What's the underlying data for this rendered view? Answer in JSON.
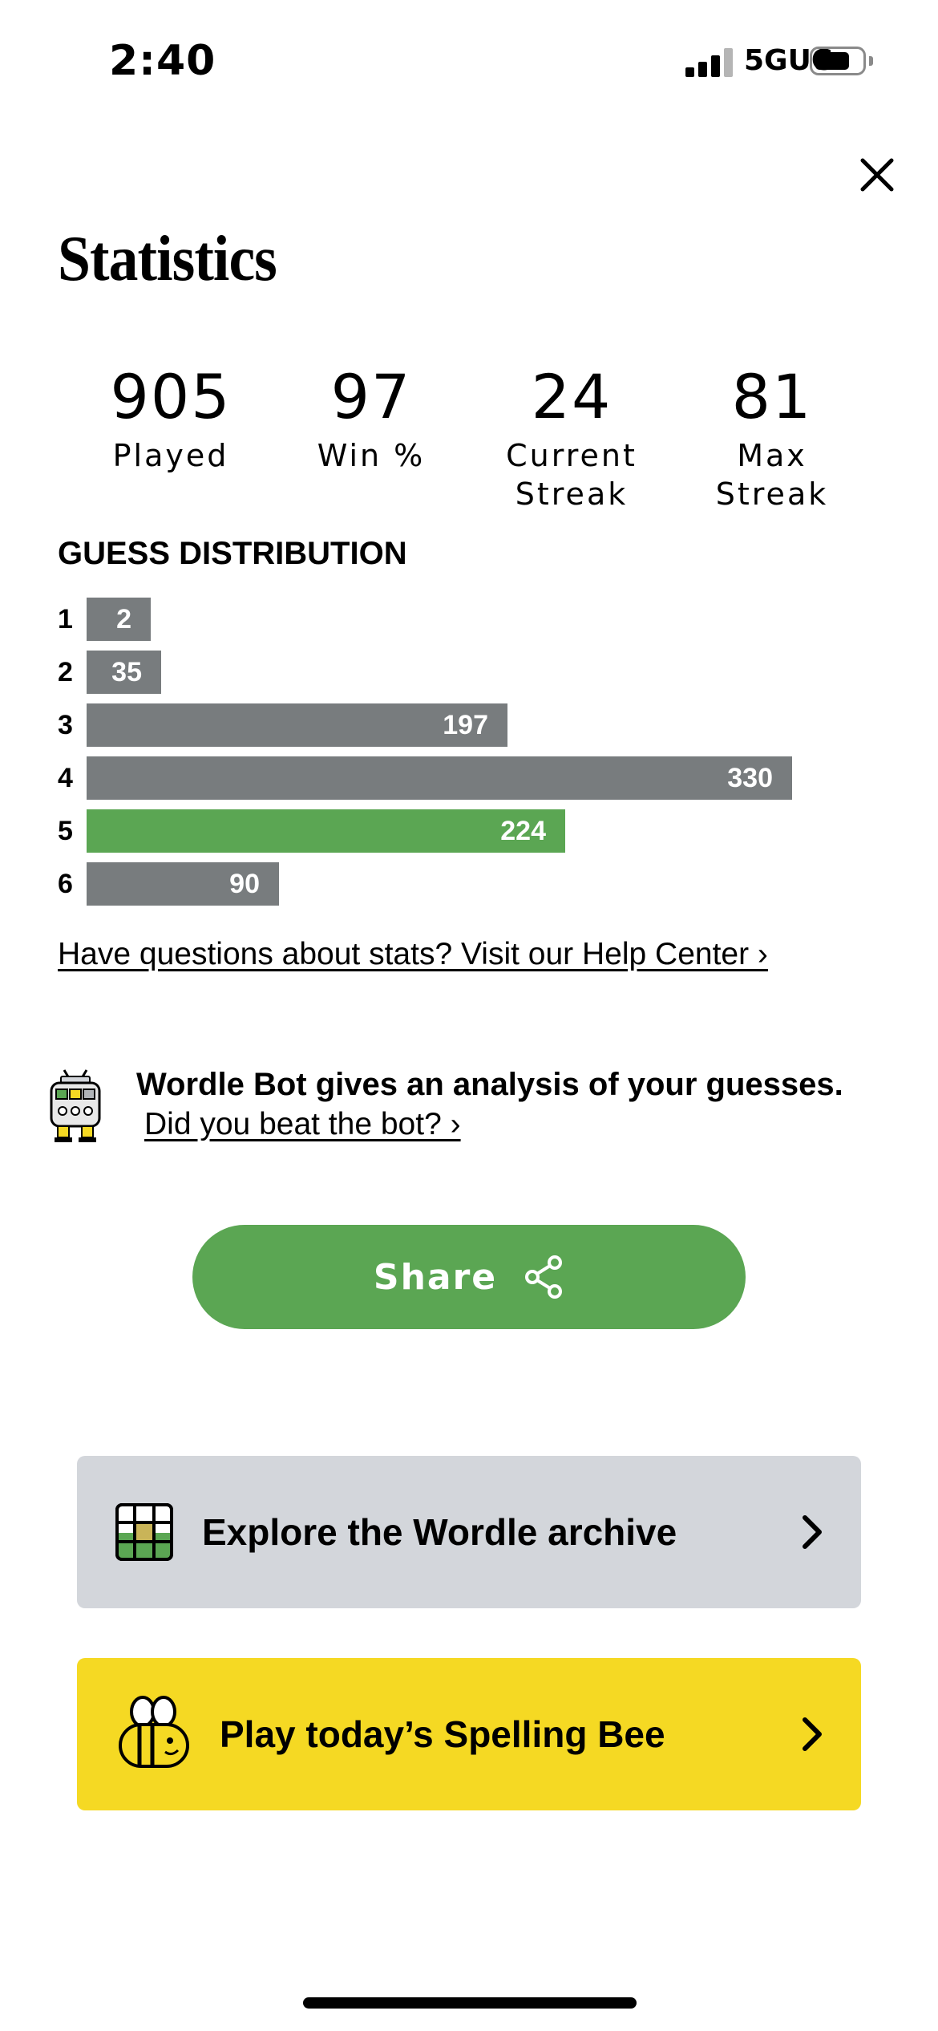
{
  "status_bar": {
    "time": "2:40",
    "network": "5GUC"
  },
  "title": "Statistics",
  "stats": [
    {
      "value": "905",
      "label": "Played"
    },
    {
      "value": "97",
      "label": "Win %"
    },
    {
      "value": "24",
      "label": "Current\nStreak"
    },
    {
      "value": "81",
      "label": "Max\nStreak"
    }
  ],
  "distribution": {
    "title": "GUESS DISTRIBUTION",
    "max": 330,
    "highlight_row": 5,
    "rows": [
      {
        "guess": "1",
        "count": 2
      },
      {
        "guess": "2",
        "count": 35
      },
      {
        "guess": "3",
        "count": 197
      },
      {
        "guess": "4",
        "count": 330
      },
      {
        "guess": "5",
        "count": 224
      },
      {
        "guess": "6",
        "count": 90
      }
    ]
  },
  "help_link": "Have questions about stats? Visit our Help Center ›",
  "bot": {
    "text": "Wordle Bot gives an analysis of your guesses.",
    "link": "Did you beat the bot? ›"
  },
  "share": {
    "label": "Share"
  },
  "promos": {
    "archive": {
      "label": "Explore the Wordle archive"
    },
    "bee": {
      "label": "Play today’s Spelling Bee"
    }
  },
  "colors": {
    "green": "#5ba653",
    "gray_bar": "#787c7e",
    "archive_bg": "#d3d6db",
    "bee_bg": "#f5d923"
  }
}
